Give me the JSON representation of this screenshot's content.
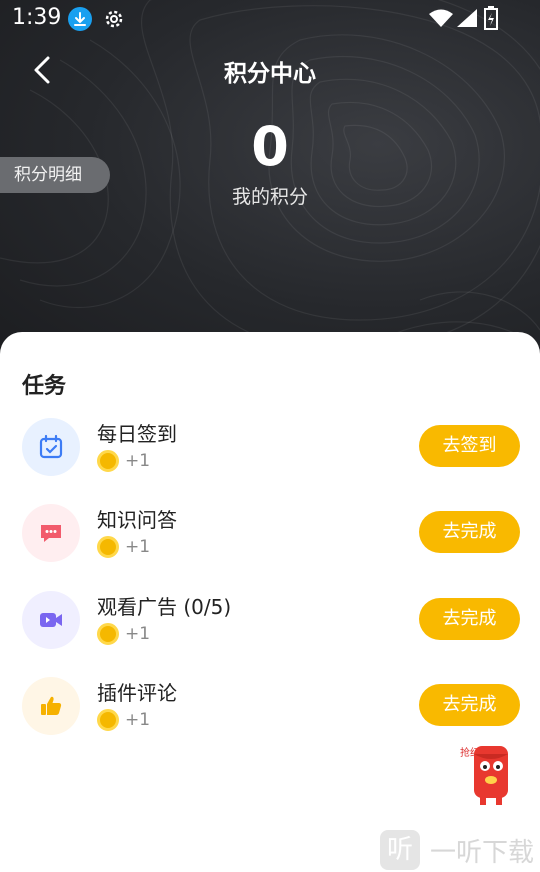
{
  "status": {
    "time": "1:39"
  },
  "header": {
    "title": "积分中心"
  },
  "points": {
    "value": "0",
    "label": "我的积分"
  },
  "detail_button": "积分明细",
  "tasks_section": {
    "title": "任务",
    "items": [
      {
        "name": "每日签到",
        "reward": "+1",
        "action": "去签到",
        "icon": "calendar-check-icon",
        "icon_bg": "#e8f1ff",
        "icon_color": "#3d7cf5"
      },
      {
        "name": "知识问答",
        "reward": "+1",
        "action": "去完成",
        "icon": "chat-bubble-icon",
        "icon_bg": "#ffeef0",
        "icon_color": "#f25b6c"
      },
      {
        "name": "观看广告 (0/5)",
        "reward": "+1",
        "action": "去完成",
        "icon": "video-camera-icon",
        "icon_bg": "#f0efff",
        "icon_color": "#7a66f0"
      },
      {
        "name": "插件评论",
        "reward": "+1",
        "action": "去完成",
        "icon": "thumbs-up-icon",
        "icon_bg": "#fff6e6",
        "icon_color": "#f6b100"
      }
    ]
  },
  "mascot_caption": "抢红包了",
  "watermark": {
    "logo": "听",
    "text": "一听下载"
  },
  "colors": {
    "accent": "#f9b900",
    "hero_bg": "#26282c"
  }
}
